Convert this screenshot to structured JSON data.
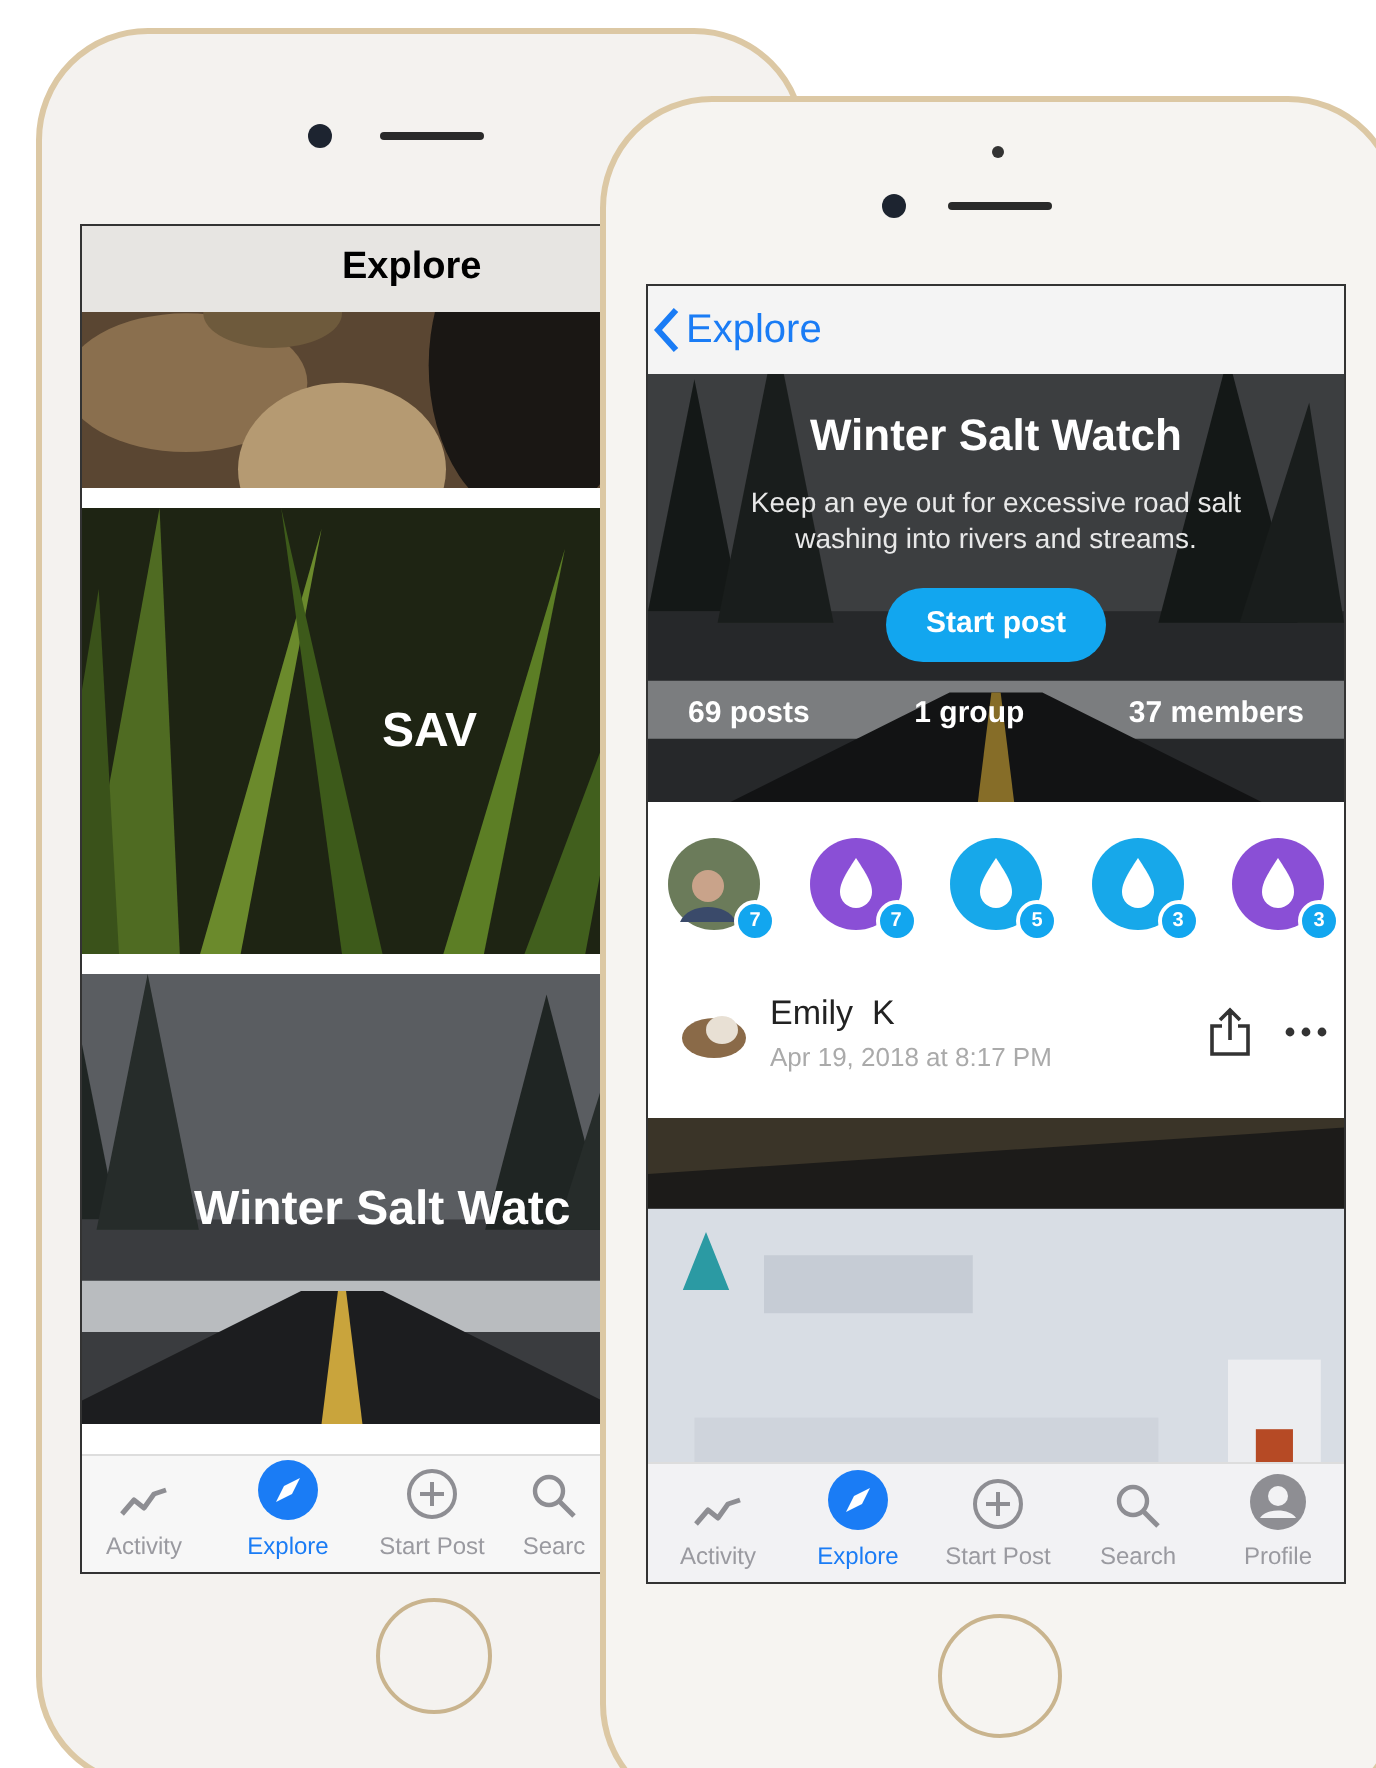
{
  "left_phone": {
    "nav_title": "Explore",
    "tiles": [
      {
        "kind": "picture"
      },
      {
        "kind": "titled",
        "title": "SAV"
      },
      {
        "kind": "titled",
        "title": "Winter Salt Watc"
      }
    ],
    "tab_bar": [
      {
        "label": "Activity",
        "selected": false
      },
      {
        "label": "Explore",
        "selected": true
      },
      {
        "label": "Start Post",
        "selected": false
      },
      {
        "label": "Searc",
        "selected": false
      }
    ]
  },
  "right_phone": {
    "back_label": "Explore",
    "header": {
      "title": "Winter Salt Watch",
      "description": "Keep an eye out for excessive road salt washing into rivers and streams.",
      "button": "Start post",
      "stats": [
        "69 posts",
        "1 group",
        "37 members"
      ]
    },
    "members": [
      {
        "kind": "avatar",
        "count": "7"
      },
      {
        "kind": "drop",
        "color": "#8a4fd6",
        "count": "7"
      },
      {
        "kind": "drop",
        "color": "#17a8ea",
        "count": "5"
      },
      {
        "kind": "drop",
        "color": "#17a8ea",
        "count": "3"
      },
      {
        "kind": "drop",
        "color": "#8a4fd6",
        "count": "3"
      }
    ],
    "post": {
      "author": "Emily  K",
      "date": "Apr 19, 2018 at 8:17 PM"
    },
    "tab_bar": [
      {
        "label": "Activity",
        "selected": false
      },
      {
        "label": "Explore",
        "selected": true
      },
      {
        "label": "Start Post",
        "selected": false
      },
      {
        "label": "Search",
        "selected": false
      },
      {
        "label": "Profile",
        "selected": false
      }
    ]
  }
}
